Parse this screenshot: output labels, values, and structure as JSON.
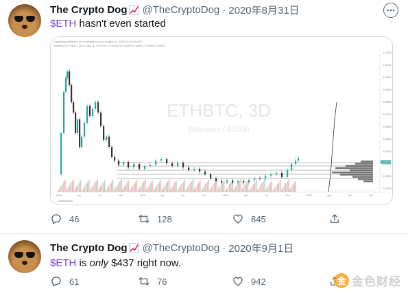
{
  "tweets": [
    {
      "name": "The Crypto Dog",
      "handle": "@TheCryptoDog",
      "separator": "·",
      "date": "2020年8月31日",
      "text_cashtag": "$ETH",
      "text_rest": " hasn't even started",
      "chart": {
        "symbol": "ETHBTC, 3D",
        "subtitle": "Ethereum / Bitcoin",
        "top_text": "cryptodog published on TradingView.com, August 31, 2020 10:32:05 UTC",
        "top_text_2": "BINANCE:ETHBTC, 3D 0.0364 ▲ +0.0016 (+4.53%) O:0.0348 H:0.0366 L:0.0348 C:0.0364",
        "footer": "TradingView",
        "x_labels": [
          "2018",
          "Apr",
          "Jul",
          "Oct",
          "2019",
          "Apr",
          "Jul",
          "Oct",
          "2020",
          "Apr",
          "Jul",
          "Oct",
          "2021",
          "Apr",
          "Jul",
          "Oct"
        ],
        "price_labels": [
          "0.12500",
          "0.11500",
          "0.10500",
          "0.09500",
          "0.08500",
          "0.07500",
          "0.06500",
          "0.05500",
          "0.04500",
          "0.03500",
          "0.02500",
          "0.01500"
        ],
        "current_price": "0.036400"
      },
      "replies": "46",
      "retweets": "128",
      "likes": "845"
    },
    {
      "name": "The Crypto Dog",
      "handle": "@TheCryptoDog",
      "separator": "·",
      "date": "2020年9月1日",
      "text_cashtag": "$ETH",
      "text_is": " is ",
      "text_only": "only",
      "text_rest": " $437 right now.",
      "replies": "61",
      "retweets": "76",
      "likes": "942"
    }
  ],
  "watermark": {
    "logo": "金",
    "text": "金色财经"
  },
  "colors": {
    "cashtag": "#7b3fd4",
    "muted": "#536471",
    "candle_up": "#26a69a",
    "candle_down": "#ef5350"
  },
  "icons": [
    "reply-icon",
    "retweet-icon",
    "like-icon",
    "share-icon",
    "chart-increasing-icon",
    "more-icon"
  ]
}
